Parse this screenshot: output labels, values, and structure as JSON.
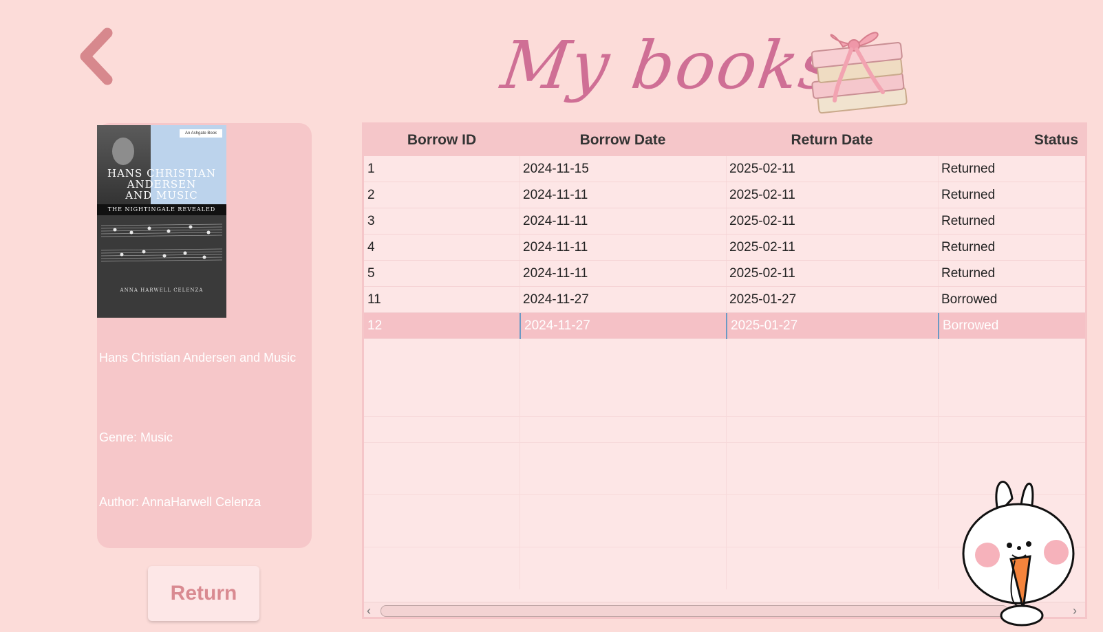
{
  "header": {
    "title": "My books"
  },
  "book": {
    "cover": {
      "publisher": "An Ashgate Book",
      "title_lines": [
        "HANS CHRISTIAN",
        "ANDERSEN",
        "AND MUSIC"
      ],
      "subtitle": "THE NIGHTINGALE REVEALED",
      "author": "ANNA HARWELL CELENZA"
    },
    "title": "Hans Christian Andersen and Music",
    "genre": "Genre: Music",
    "author": "Author: AnnaHarwell Celenza"
  },
  "actions": {
    "return_label": "Return"
  },
  "table": {
    "columns": [
      "Borrow ID",
      "Borrow Date",
      "Return Date",
      "Status"
    ],
    "rows": [
      {
        "id": "1",
        "borrow_date": "2024-11-15",
        "return_date": "2025-02-11",
        "status": "Returned"
      },
      {
        "id": "2",
        "borrow_date": "2024-11-11",
        "return_date": "2025-02-11",
        "status": "Returned"
      },
      {
        "id": "3",
        "borrow_date": "2024-11-11",
        "return_date": "2025-02-11",
        "status": "Returned"
      },
      {
        "id": "4",
        "borrow_date": "2024-11-11",
        "return_date": "2025-02-11",
        "status": "Returned"
      },
      {
        "id": "5",
        "borrow_date": "2024-11-11",
        "return_date": "2025-02-11",
        "status": "Returned"
      },
      {
        "id": "11",
        "borrow_date": "2024-11-27",
        "return_date": "2025-01-27",
        "status": "Borrowed"
      },
      {
        "id": "12",
        "borrow_date": "2024-11-27",
        "return_date": "2025-01-27",
        "status": "Borrowed",
        "selected": true
      }
    ]
  },
  "colors": {
    "background": "#fcdcd9",
    "accent": "#cf6f95",
    "selected_row": "#f5c1c6",
    "panel": "#f6c7c9"
  },
  "icons": {
    "back": "chevron-left-icon",
    "decoration": "stacked-books-bow-icon",
    "mascot": "bunny-carrot-icon"
  }
}
